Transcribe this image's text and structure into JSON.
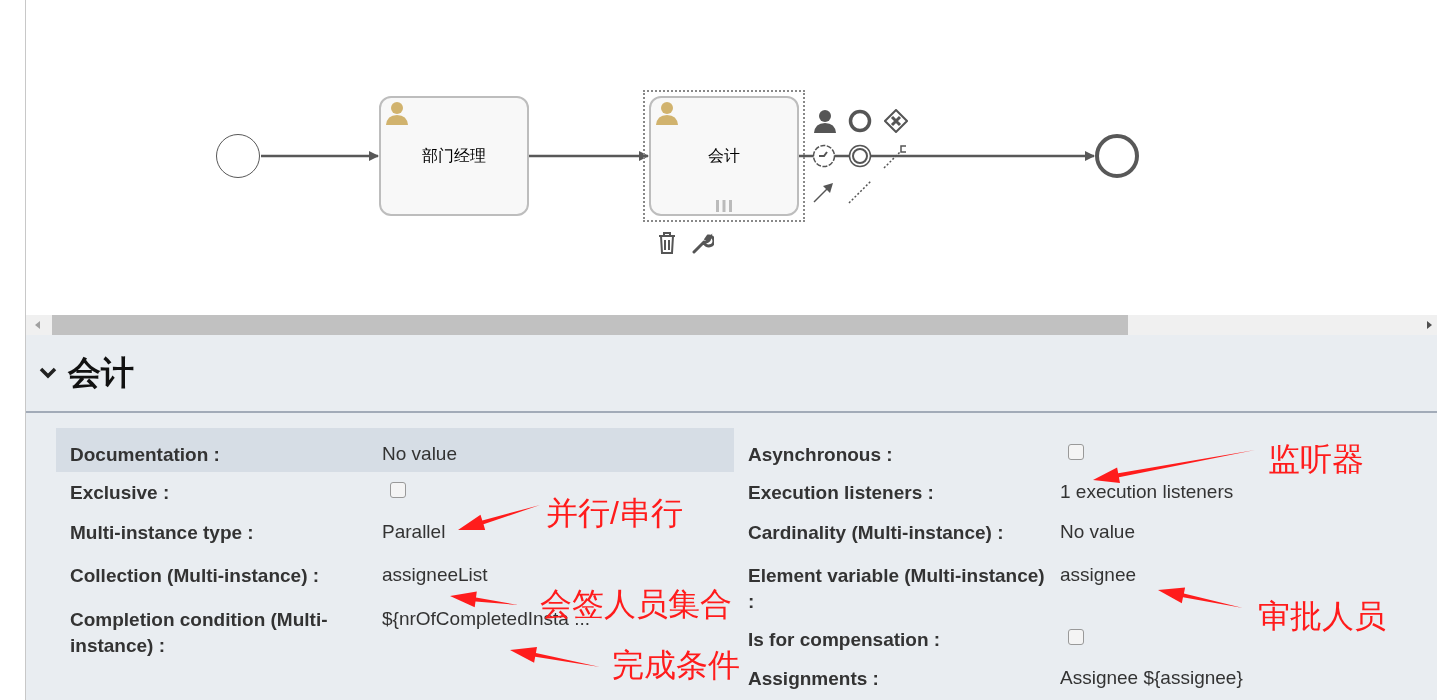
{
  "diagram": {
    "nodes": [
      {
        "kind": "start"
      },
      {
        "kind": "user_task",
        "label": "部门经理",
        "selected": false,
        "multi_instance": false
      },
      {
        "kind": "user_task",
        "label": "会计",
        "selected": true,
        "multi_instance": true
      },
      {
        "kind": "end"
      }
    ]
  },
  "properties": {
    "title": "会计",
    "expanded": true,
    "left": [
      {
        "kind": "text",
        "label": "Documentation :",
        "value": "No value",
        "highlighted": true
      },
      {
        "kind": "checkbox",
        "label": "Exclusive :",
        "checked": false,
        "highlighted": false
      },
      {
        "kind": "text",
        "label": "Multi-instance type :",
        "value": "Parallel",
        "highlighted": false
      },
      {
        "kind": "text",
        "label": "Collection (Multi-instance) :",
        "value": "assigneeList",
        "highlighted": false
      },
      {
        "kind": "text",
        "label": "Completion condition (Multi-instance) :",
        "value": "${nrOfCompletedInsta ...",
        "highlighted": false
      }
    ],
    "right": [
      {
        "kind": "checkbox",
        "label": "Asynchronous :",
        "checked": false,
        "highlighted": false
      },
      {
        "kind": "text",
        "label": "Execution listeners :",
        "value": "1 execution listeners",
        "highlighted": false
      },
      {
        "kind": "text",
        "label": "Cardinality (Multi-instance) :",
        "value": "No value",
        "highlighted": false
      },
      {
        "kind": "text",
        "label": "Element variable (Multi-instance) :",
        "value": "assignee",
        "highlighted": false
      },
      {
        "kind": "checkbox",
        "label": "Is for compensation :",
        "checked": false,
        "highlighted": false
      },
      {
        "kind": "text",
        "label": "Assignments :",
        "value": "Assignee ${assignee}",
        "highlighted": false
      }
    ]
  },
  "annotations": [
    {
      "text": "监听器"
    },
    {
      "text": "并行/串行"
    },
    {
      "text": "会签人员集合"
    },
    {
      "text": "审批人员"
    },
    {
      "text": "完成条件"
    }
  ]
}
